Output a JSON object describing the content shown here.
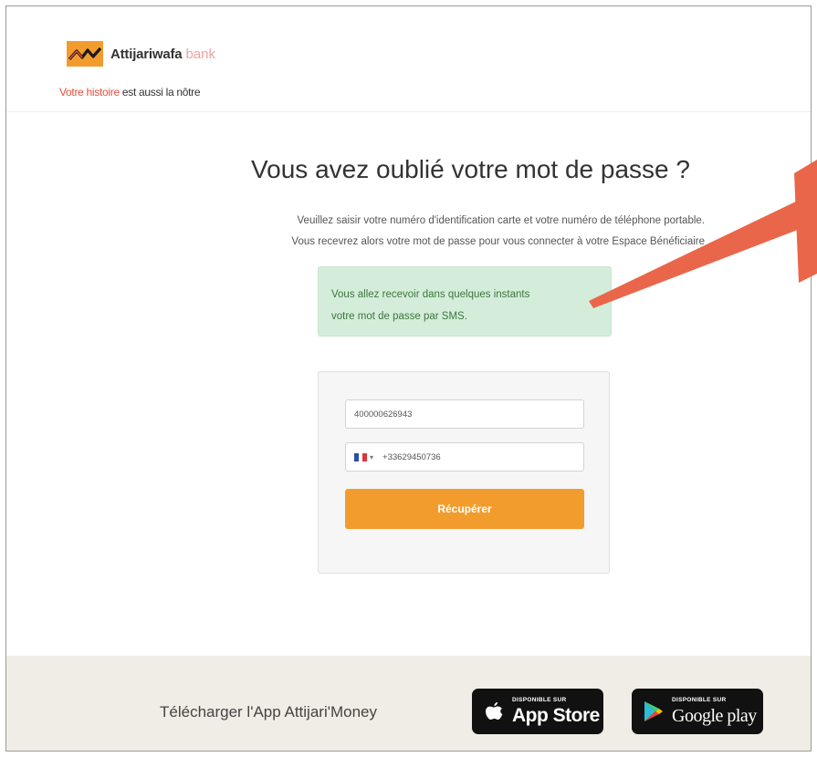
{
  "brand": {
    "name": "Attijariwafa",
    "suffix": "bank",
    "tagline_highlight": "Votre histoire",
    "tagline_rest": "est aussi la nôtre",
    "colors": {
      "primary": "#f39c2e",
      "accent": "#e84e3c"
    }
  },
  "page": {
    "title": "Vous avez oublié votre mot de passe ?",
    "description_line1": "Veuillez saisir votre numéro d'identification carte et votre numéro de téléphone portable.",
    "description_line2": "Vous recevrez alors votre mot de passe pour vous connecter à votre Espace Bénéficiaire"
  },
  "alert": {
    "line1": "Vous allez recevoir dans quelques instants",
    "line2": "votre mot de passe par SMS.",
    "color": "#d4edda"
  },
  "form": {
    "card_id_value": "400000626943",
    "phone_value": "+33629450736",
    "phone_country_flag": "fr-flag-icon",
    "submit_label": "Récupérer"
  },
  "footer": {
    "download_text": "Télécharger l'App Attijari'Money",
    "appstore_small": "DISPONIBLE SUR",
    "appstore_big": "App Store",
    "googleplay_small": "DISPONIBLE SUR",
    "googleplay_big": "Google play"
  }
}
